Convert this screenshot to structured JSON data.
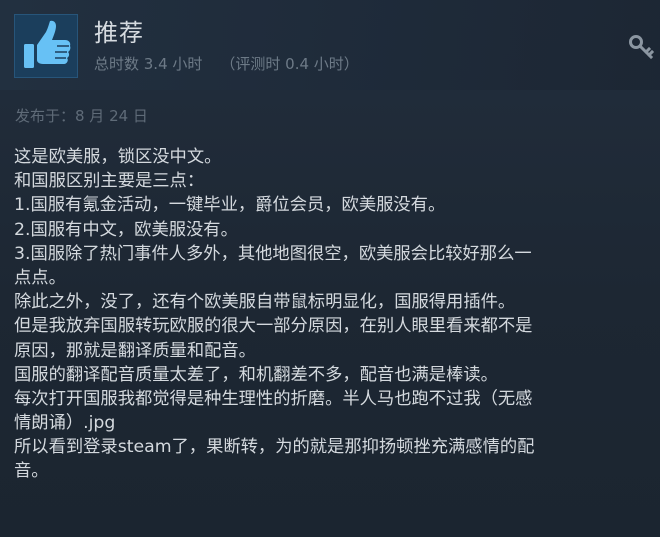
{
  "review": {
    "verdict": "推荐",
    "hours_total": "总时数 3.4 小时",
    "hours_at_review": "（评测时 0.4 小时）",
    "posted": "发布于：8 月 24 日",
    "icons": {
      "thumb": "thumbs-up-icon",
      "award": "award-icon"
    },
    "lines": [
      "这是欧美服，锁区没中文。",
      "和国服区别主要是三点：",
      "1.国服有氪金活动，一键毕业，爵位会员，欧美服没有。",
      "2.国服有中文，欧美服没有。",
      "3.国服除了热门事件人多外，其他地图很空，欧美服会比较好那么一",
      "点点。",
      "除此之外，没了，还有个欧美服自带鼠标明显化，国服得用插件。",
      "但是我放弃国服转玩欧服的很大一部分原因，在别人眼里看来都不是",
      "原因，那就是翻译质量和配音。",
      "国服的翻译配音质量太差了，和机翻差不多，配音也满是棒读。",
      "每次打开国服我都觉得是种生理性的折磨。半人马也跑不过我（无感",
      "情朗诵）.jpg",
      "所以看到登录steam了，果断转，为的就是那抑扬顿挫充满感情的配",
      "音。"
    ]
  },
  "colors": {
    "background": "#1f2a38",
    "verdict_text": "#d6dbe0",
    "muted_text": "#6d7a87",
    "body_text": "#d4d9de",
    "thumb_bg": "#1b3e5c",
    "thumb_icon": "#67c1f5"
  }
}
